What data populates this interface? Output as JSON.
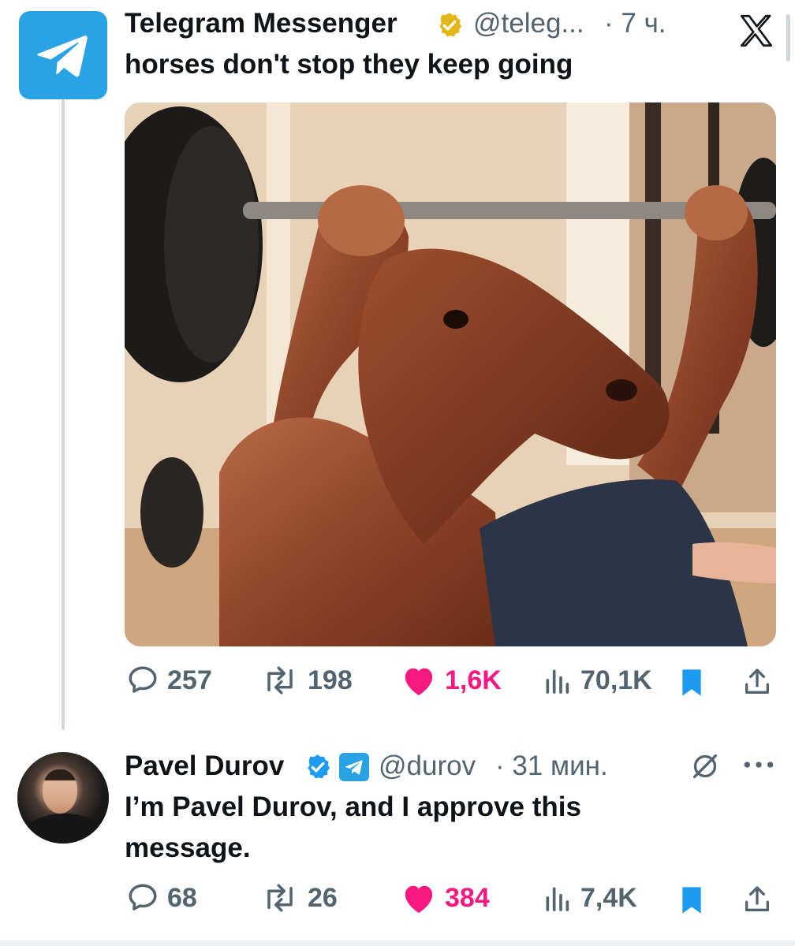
{
  "tweet1": {
    "author_name": "Telegram Messenger",
    "handle": "@teleg...",
    "time": "· 7 ч.",
    "text": "horses don't stop they keep going",
    "verified": "gold-check-badge",
    "avatar_icon": "telegram-logo-icon",
    "actions": {
      "replies": "257",
      "reposts": "198",
      "likes": "1,6K",
      "views": "70,1K"
    }
  },
  "tweet2": {
    "author_name": "Pavel Durov",
    "handle": "@durov",
    "time": "· 31 мин.",
    "text": "I’m Pavel Durov, and I approve this message.",
    "verified": "blue-check-badge",
    "affiliate": "telegram-badge-icon",
    "actions": {
      "replies": "68",
      "reposts": "26",
      "likes": "384",
      "views": "7,4K"
    }
  },
  "colors": {
    "telegram_blue": "#2aa3e6",
    "like_pink": "#f91880",
    "bookmark_blue": "#1d9bf0",
    "muted_gray": "#536471",
    "thread_line": "#cfd9de",
    "gold_badge": "#e2b719"
  }
}
